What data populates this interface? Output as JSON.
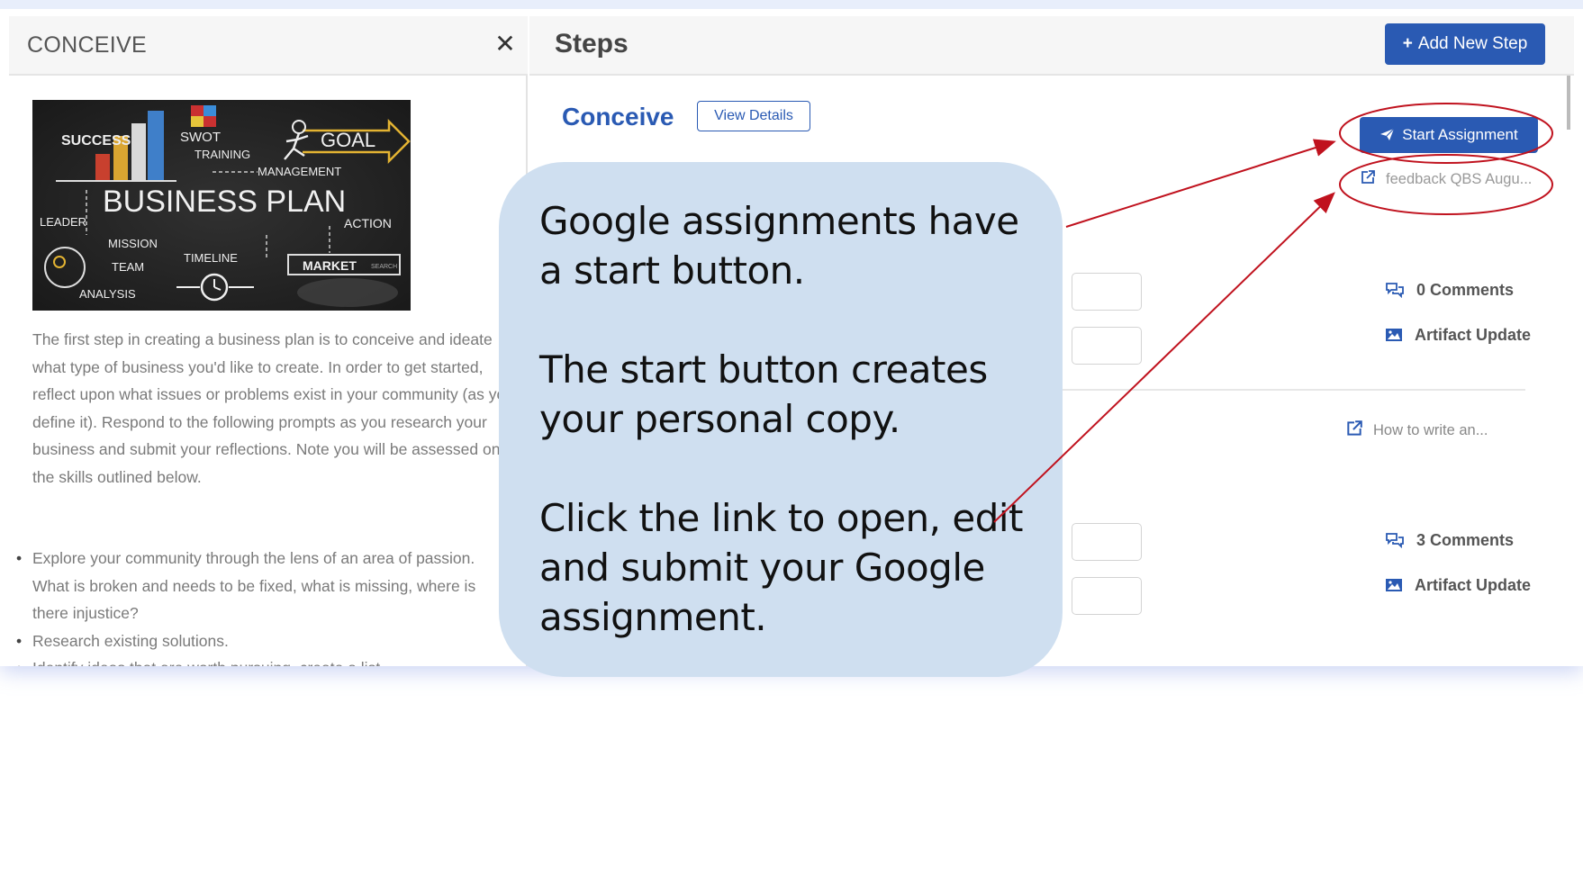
{
  "left_panel": {
    "title": "CONCEIVE",
    "close_glyph": "✕",
    "image_words": {
      "success": "SUCCESS",
      "swot": "SWOT",
      "goal": "GOAL",
      "training": "TRAINING",
      "management": "MANAGEMENT",
      "business_plan": "BUSINESS PLAN",
      "leader": "LEADER",
      "action": "ACTION",
      "mission": "MISSION",
      "timeline": "TIMELINE",
      "market": "MARKET",
      "search": "SEARCH",
      "team": "TEAM",
      "analysis": "ANALYSIS"
    },
    "intro": "The first step in creating a business plan is to conceive and ideate what type of business  you'd like to create. In order to get started, reflect upon what issues or problems exist in your community (as you define it). Respond to the following prompts as you research your business and submit your reflections. Note you will be assessed on the skills outlined below.",
    "bullets": [
      "Explore your community through the lens of an area of passion. What is broken and needs to be fixed, what is missing, where is there injustice?",
      "Research existing solutions.",
      "Identify ideas that are worth pursuing, create a list"
    ]
  },
  "right_panel": {
    "title": "Steps",
    "add_step_label": "Add New Step",
    "add_step_icon": "+",
    "step_name": "Conceive",
    "view_details_label": "View Details",
    "start_assignment_label": "Start Assignment",
    "start_icon": "paper-plane-icon",
    "feedback_link": "feedback QBS Augu...",
    "howto_link": "How to write an...",
    "rows": [
      {
        "comments": "0 Comments",
        "artifact": "Artifact Update"
      },
      {
        "comments": "3 Comments",
        "artifact": "Artifact Update"
      }
    ]
  },
  "annotation": {
    "text": "Google assignments have a start button.\n\nThe start button creates your personal copy.\n\n Click the link to open, edit and submit your Google assignment.",
    "highlight_color": "#c0121e",
    "bubble_color": "#cfdff0"
  },
  "colors": {
    "primary": "#2a5ab3",
    "muted_text": "#7a7a7a"
  }
}
